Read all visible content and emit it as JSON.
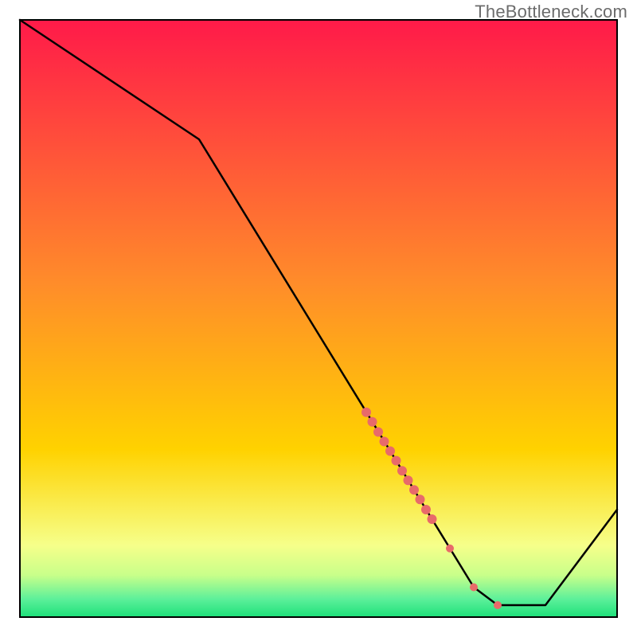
{
  "watermark": {
    "text": "TheBottleneck.com"
  },
  "colors": {
    "gradient_top": "#ff1a49",
    "gradient_mid": "#ffd200",
    "gradient_low": "#f6ff8a",
    "gradient_green": "#1ee07a",
    "line": "#000000",
    "marker": "#e86a6a",
    "border": "#000000",
    "watermark": "#6c6c6c"
  },
  "chart_data": {
    "type": "line",
    "title": "",
    "xlabel": "",
    "ylabel": "",
    "xlim": [
      0,
      100
    ],
    "ylim": [
      0,
      100
    ],
    "grid": false,
    "legend": false,
    "series": [
      {
        "name": "bottleneck-curve",
        "x": [
          0,
          30,
          76,
          80,
          88,
          100
        ],
        "y": [
          100,
          80,
          5,
          2,
          2,
          18
        ]
      }
    ],
    "markers": [
      {
        "name": "highlight-dots",
        "x": [
          58,
          59,
          60,
          61,
          62,
          63,
          64,
          65,
          66,
          67,
          68,
          69,
          72,
          76,
          80
        ],
        "y": [
          34.3,
          32.7,
          31.0,
          29.4,
          27.8,
          26.2,
          24.5,
          22.9,
          21.3,
          19.7,
          18.0,
          16.4,
          11.5,
          5,
          2
        ]
      }
    ],
    "background_bands": [
      {
        "from_y": 100,
        "to_y": 20,
        "kind": "gradient-red-yellow"
      },
      {
        "from_y": 20,
        "to_y": 6,
        "kind": "pale-yellow"
      },
      {
        "from_y": 6,
        "to_y": 0,
        "kind": "green"
      }
    ]
  }
}
